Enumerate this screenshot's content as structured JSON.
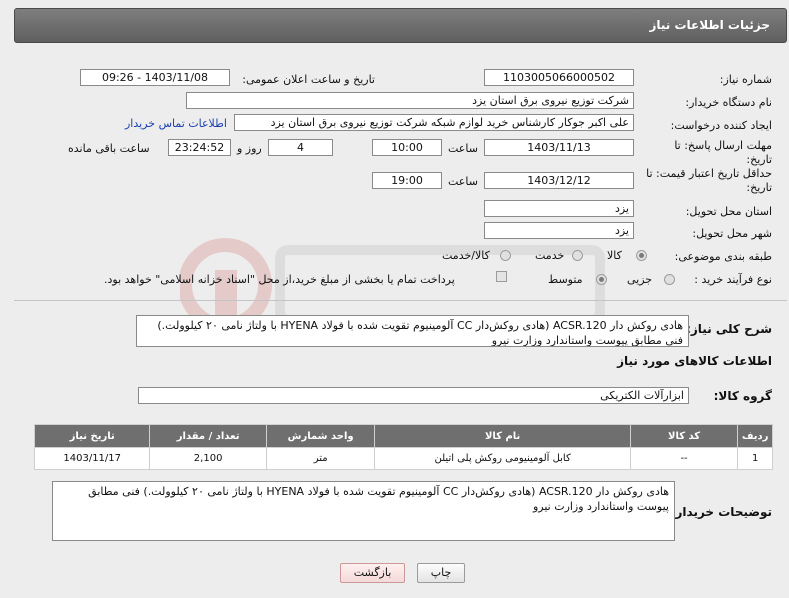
{
  "header": {
    "title": "جزئیات اطلاعات نیاز"
  },
  "fields": {
    "need_number_label": "شماره نیاز:",
    "need_number": "1103005066000502",
    "announce_label": "تاریخ و ساعت اعلان عمومی:",
    "announce_value": "1403/11/08 - 09:26",
    "buyer_org_label": "نام دستگاه خریدار:",
    "buyer_org": "شرکت توزیع نیروی برق استان یزد",
    "creator_label": "ایجاد کننده درخواست:",
    "creator": "علی اکبر جوکار  کارشناس خرید لوازم شبکه  شرکت توزیع نیروی برق استان یزد",
    "contact_link": "اطلاعات تماس خریدار",
    "deadline_label_1": "مهلت ارسال پاسخ: تا",
    "deadline_label_2": "تاریخ:",
    "deadline_date": "1403/11/13",
    "time_label": "ساعت",
    "deadline_time": "10:00",
    "days": "4",
    "days_label": "روز و",
    "remaining_time": "23:24:52",
    "remaining_label": "ساعت باقی مانده",
    "validity_label_1": "حداقل تاریخ اعتبار قیمت: تا",
    "validity_label_2": "تاریخ:",
    "validity_date": "1403/12/12",
    "validity_time": "19:00",
    "province_label": "استان محل تحویل:",
    "province": "یزد",
    "city_label": "شهر محل تحویل:",
    "city": "یزد",
    "category_label": "طبقه بندی موضوعی:",
    "category_options": [
      "کالا",
      "خدمت",
      "کالا/خدمت"
    ],
    "process_label": "نوع فرآیند خرید :",
    "process_options": [
      "جزیی",
      "متوسط"
    ],
    "payment_note": "پرداخت تمام یا بخشی از مبلغ خرید،از محل \"اسناد خزانه اسلامی\" خواهد بود."
  },
  "summary": {
    "label": "شرح کلی نیاز:",
    "text": "هادی روکش دار ACSR.120 (هادی روکش‌دار CC آلومینیوم تقویت شده با فولاد HYENA با ولتاژ نامی ۲۰ کیلوولت.)  فنی مطابق پیوست واستاندارد وزارت نیرو"
  },
  "goods": {
    "section_title": "اطلاعات کالاهای مورد نیاز",
    "group_label": "گروه کالا:",
    "group_value": "ابزارآلات الکتریکی",
    "columns": [
      "ردیف",
      "کد کالا",
      "نام کالا",
      "واحد شمارش",
      "تعداد / مقدار",
      "تاریخ نیاز"
    ],
    "rows": [
      [
        "1",
        "--",
        "کابل آلومینیومی روکش پلی اتیلن",
        "متر",
        "2,100",
        "1403/11/17"
      ]
    ]
  },
  "buyer_notes": {
    "label": "توضیحات خریدار:",
    "text": "هادی روکش دار ACSR.120 (هادی روکش‌دار CC آلومینیوم تقویت شده با فولاد HYENA با ولتاژ نامی ۲۰ کیلوولت.)  فنی مطابق پیوست واستاندارد وزارت نیرو"
  },
  "buttons": {
    "print": "چاپ",
    "back": "بازگشت"
  }
}
